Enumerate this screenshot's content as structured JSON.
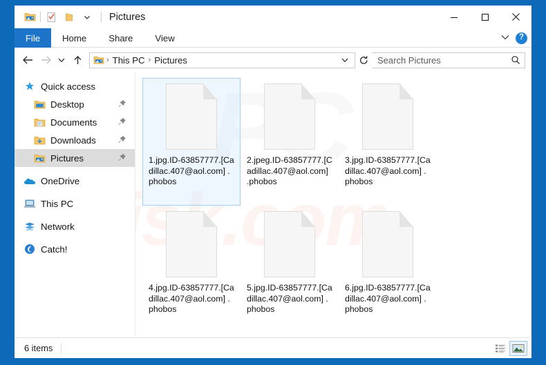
{
  "window": {
    "title": "Pictures",
    "frame_color": "#0d6ab8",
    "quick_access": [
      {
        "name": "pictures-folder-icon",
        "label": "Pictures"
      },
      {
        "name": "properties-icon",
        "label": "Properties"
      },
      {
        "name": "new-folder-icon",
        "label": "New folder"
      },
      {
        "name": "customize-chevron-icon",
        "label": "Customize Quick Access Toolbar"
      }
    ],
    "controls": {
      "minimize": "─",
      "maximize": "□",
      "close": "✕"
    }
  },
  "ribbon": {
    "tabs": [
      {
        "label": "File",
        "active_style": "file"
      },
      {
        "label": "Home",
        "active_style": "normal"
      },
      {
        "label": "Share",
        "active_style": "normal"
      },
      {
        "label": "View",
        "active_style": "normal"
      }
    ],
    "collapse_icon": "⌄",
    "help_label": "?"
  },
  "navigation": {
    "back_icon": "←",
    "forward_icon": "→",
    "recent_icon": "⌄",
    "up_icon": "↑",
    "breadcrumb": [
      "This PC",
      "Pictures"
    ],
    "breadcrumb_separator": "›",
    "address_dropdown_icon": "⌄",
    "refresh_icon": "↻"
  },
  "search": {
    "placeholder": "Search Pictures",
    "value": "",
    "icon": "search-icon"
  },
  "sidebar": {
    "items": [
      {
        "label": "Quick access",
        "icon": "star-pin-icon",
        "indent": false,
        "pinned": false,
        "selected": false,
        "gap": false
      },
      {
        "label": "Desktop",
        "icon": "desktop-folder-icon",
        "indent": true,
        "pinned": true,
        "selected": false,
        "gap": false
      },
      {
        "label": "Documents",
        "icon": "documents-folder-icon",
        "indent": true,
        "pinned": true,
        "selected": false,
        "gap": false
      },
      {
        "label": "Downloads",
        "icon": "downloads-folder-icon",
        "indent": true,
        "pinned": true,
        "selected": false,
        "gap": false
      },
      {
        "label": "Pictures",
        "icon": "pictures-folder-icon",
        "indent": true,
        "pinned": true,
        "selected": true,
        "gap": false
      },
      {
        "label": "OneDrive",
        "icon": "onedrive-cloud-icon",
        "indent": false,
        "pinned": false,
        "selected": false,
        "gap": true
      },
      {
        "label": "This PC",
        "icon": "this-pc-icon",
        "indent": false,
        "pinned": false,
        "selected": false,
        "gap": true
      },
      {
        "label": "Network",
        "icon": "network-icon",
        "indent": false,
        "pinned": false,
        "selected": false,
        "gap": true
      },
      {
        "label": "Catch!",
        "icon": "catch-app-icon",
        "indent": false,
        "pinned": false,
        "selected": false,
        "gap": true
      }
    ]
  },
  "files": [
    {
      "name": "1.jpg.ID-63857777.[Cadillac.407@aol.com] .phobos",
      "selected": true
    },
    {
      "name": "2.jpeg.ID-63857777.[Cadillac.407@aol.com] .phobos",
      "selected": false
    },
    {
      "name": "3.jpg.ID-63857777.[Cadillac.407@aol.com] .phobos",
      "selected": false
    },
    {
      "name": "4.jpg.ID-63857777.[Cadillac.407@aol.com] .phobos",
      "selected": false
    },
    {
      "name": "5.jpg.ID-63857777.[Cadillac.407@aol.com] .phobos",
      "selected": false
    },
    {
      "name": "6.jpg.ID-63857777.[Cadillac.407@aol.com] .phobos",
      "selected": false
    }
  ],
  "watermark": {
    "text_primary": "risk.com",
    "text_secondary": "PC"
  },
  "status": {
    "item_count": "6 items",
    "views": [
      {
        "name": "details-view-button",
        "active": false
      },
      {
        "name": "large-icons-view-button",
        "active": true
      }
    ]
  }
}
